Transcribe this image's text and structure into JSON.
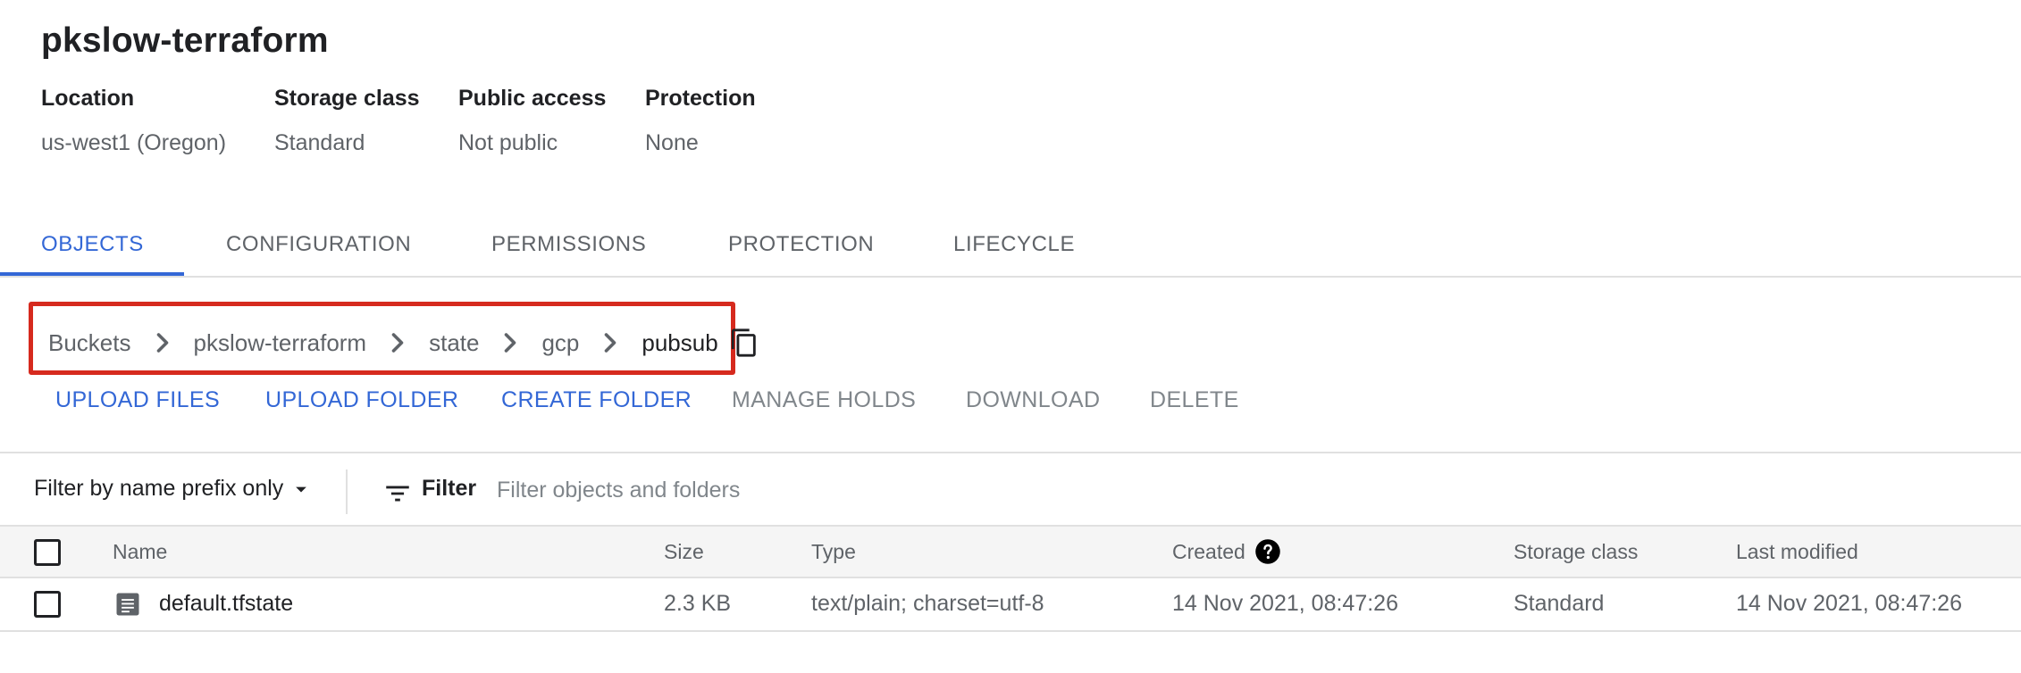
{
  "bucket": {
    "name": "pkslow-terraform",
    "details": [
      {
        "label": "Location",
        "value": "us-west1 (Oregon)"
      },
      {
        "label": "Storage class",
        "value": "Standard"
      },
      {
        "label": "Public access",
        "value": "Not public"
      },
      {
        "label": "Protection",
        "value": "None"
      }
    ]
  },
  "tabs": [
    {
      "label": "OBJECTS",
      "active": true
    },
    {
      "label": "CONFIGURATION",
      "active": false
    },
    {
      "label": "PERMISSIONS",
      "active": false
    },
    {
      "label": "PROTECTION",
      "active": false
    },
    {
      "label": "LIFECYCLE",
      "active": false
    }
  ],
  "breadcrumb": {
    "items": [
      "Buckets",
      "pkslow-terraform",
      "state",
      "gcp",
      "pubsub"
    ],
    "highlight_color": "#d62a1e"
  },
  "actions": [
    {
      "label": "UPLOAD FILES",
      "enabled": true
    },
    {
      "label": "UPLOAD FOLDER",
      "enabled": true
    },
    {
      "label": "CREATE FOLDER",
      "enabled": true
    },
    {
      "label": "MANAGE HOLDS",
      "enabled": false
    },
    {
      "label": "DOWNLOAD",
      "enabled": false
    },
    {
      "label": "DELETE",
      "enabled": false
    }
  ],
  "filter": {
    "prefix_mode": "Filter by name prefix only",
    "label": "Filter",
    "placeholder": "Filter objects and folders",
    "value": ""
  },
  "table": {
    "columns": {
      "name": "Name",
      "size": "Size",
      "type": "Type",
      "created": "Created",
      "storage_class": "Storage class",
      "last_modified": "Last modified"
    },
    "rows": [
      {
        "name": "default.tfstate",
        "size": "2.3 KB",
        "type": "text/plain; charset=utf-8",
        "created": "14 Nov 2021, 08:47:26",
        "storage_class": "Standard",
        "last_modified": "14 Nov 2021, 08:47:26"
      }
    ]
  },
  "icons": {
    "breadcrumb_separator": "chevron-right-icon",
    "copy": "copy-icon",
    "prefix_dropdown": "caret-down-icon",
    "filter": "filter-list-icon",
    "help": "help-icon",
    "file": "file-icon"
  },
  "colors": {
    "accent": "#3367d6",
    "disabled": "#80868b",
    "text_secondary": "#5f6368"
  }
}
